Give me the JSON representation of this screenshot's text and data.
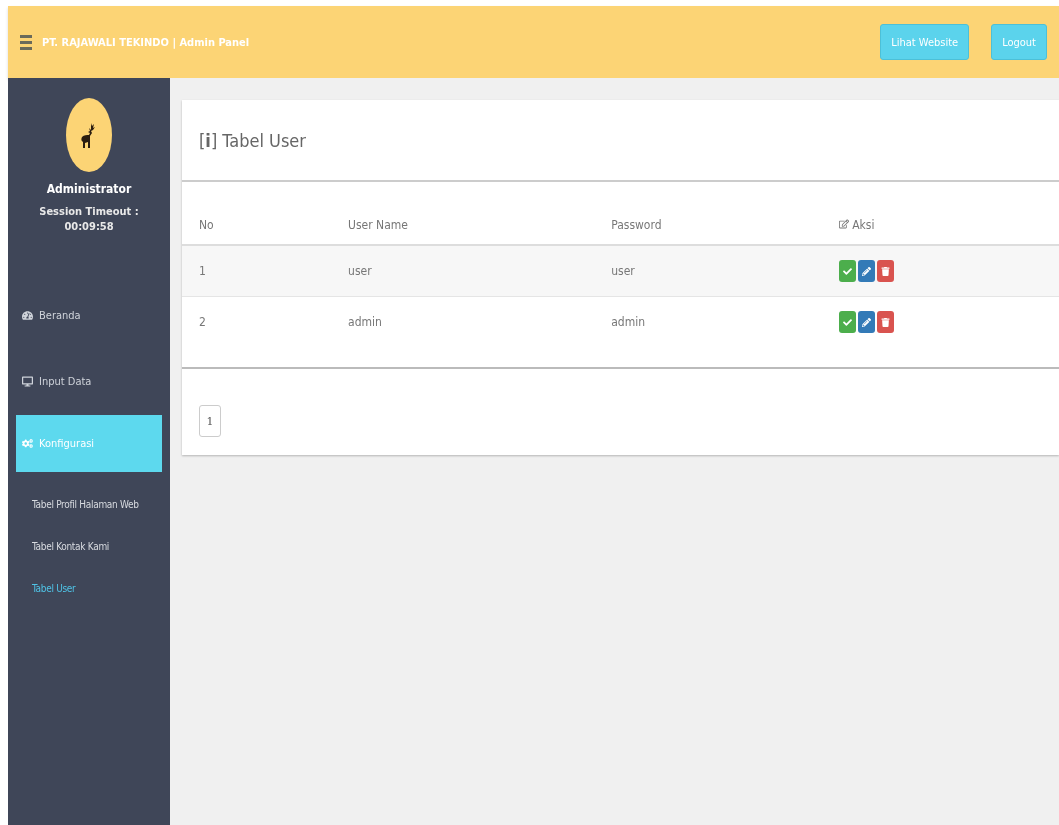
{
  "header": {
    "title": "PT. RAJAWALI TEKINDO | Admin Panel",
    "buttons": [
      "Lihat Website",
      "Logout"
    ]
  },
  "profile": {
    "name": "Administrator",
    "session_label": "Session Timeout :",
    "session_time": "00:09:58"
  },
  "sidebar": {
    "items": [
      {
        "label": "Beranda",
        "selected": false
      },
      {
        "label": "Input Data",
        "selected": false
      },
      {
        "label": "Konfigurasi",
        "selected": true,
        "children": [
          {
            "label": "Tabel Profil Halaman Web",
            "selected": false
          },
          {
            "label": "Tabel Kontak Kami",
            "selected": false
          },
          {
            "label": "Tabel User",
            "selected": true
          }
        ]
      }
    ]
  },
  "panel": {
    "title": "[**i**] Tabel User"
  },
  "table": {
    "columns": [
      "No",
      "User Name",
      "Password",
      "Aksi"
    ],
    "rows": [
      {
        "cells": [
          "1",
          "user",
          "user"
        ]
      },
      {
        "cells": [
          "2",
          "admin",
          "admin"
        ]
      }
    ]
  },
  "pagination": {
    "pages": [
      {
        "label": "1",
        "selected": true
      }
    ]
  }
}
